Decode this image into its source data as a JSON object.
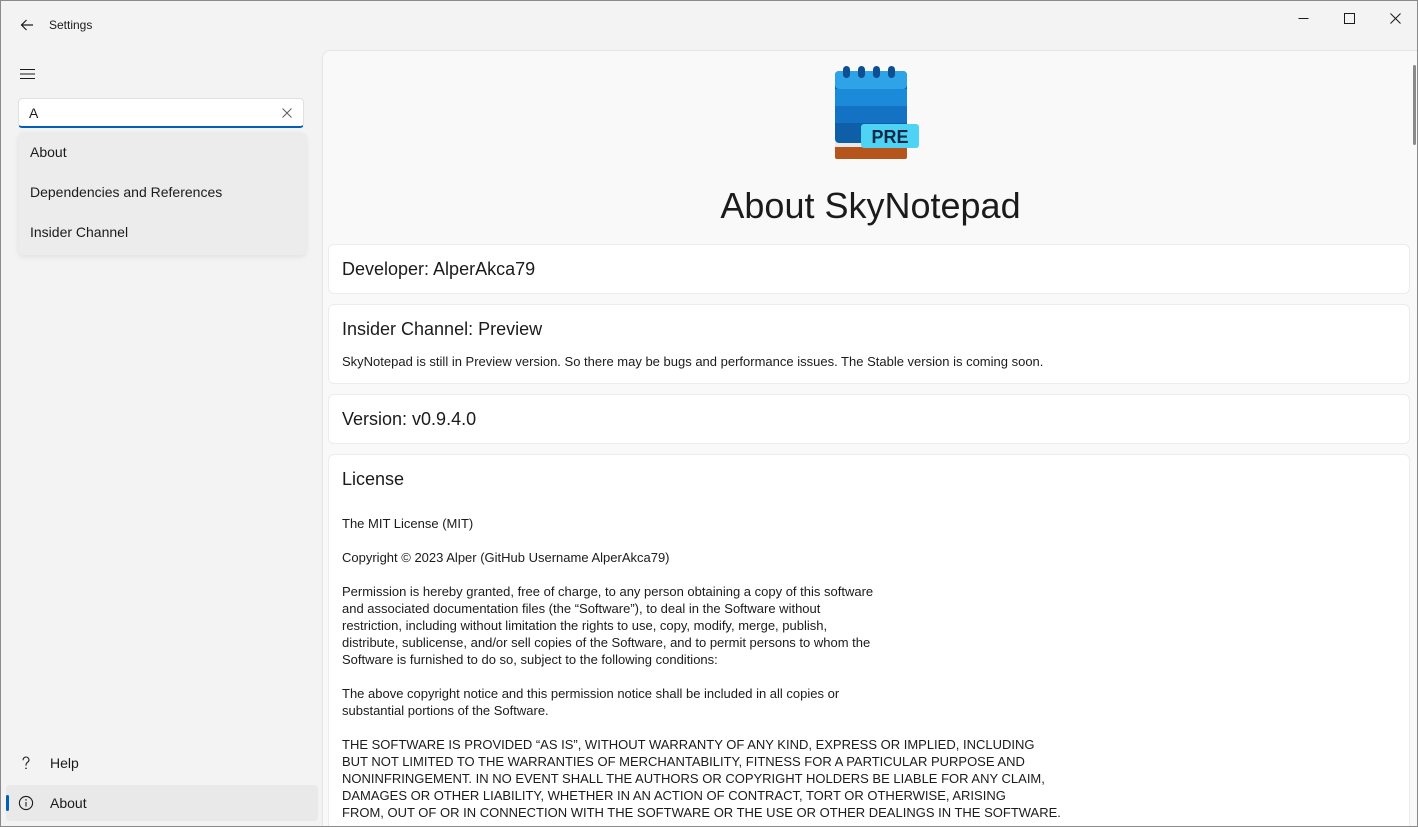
{
  "titlebar": {
    "title": "Settings",
    "back_icon": "back-arrow-icon",
    "minimize_icon": "minimize-icon",
    "maximize_icon": "maximize-icon",
    "close_icon": "close-icon"
  },
  "sidebar": {
    "menu_icon": "hamburger-icon",
    "search": {
      "value": "A",
      "clear_icon": "clear-icon"
    },
    "suggestions": [
      {
        "label": "About"
      },
      {
        "label": "Dependencies and References"
      },
      {
        "label": "Insider Channel"
      }
    ],
    "footer": [
      {
        "label": "Help",
        "icon": "help-icon"
      },
      {
        "label": "About",
        "icon": "info-icon",
        "selected": true
      }
    ]
  },
  "content": {
    "logo_badge": "PRE",
    "title": "About SkyNotepad",
    "developer": "Developer: AlperAkca79",
    "insider": {
      "heading": "Insider Channel: Preview",
      "text": "SkyNotepad is still in Preview version. So there may be bugs and performance issues. The Stable version is coming soon."
    },
    "version": "Version: v0.9.4.0",
    "license": {
      "heading": "License",
      "paragraphs": [
        "The MIT License (MIT)",
        "Copyright © 2023 Alper (GitHub Username AlperAkca79)",
        "Permission is hereby granted, free of charge, to any person obtaining a copy of this software\nand associated documentation files (the “Software”), to deal in the Software without\nrestriction, including without limitation the rights to use, copy, modify, merge, publish,\ndistribute, sublicense, and/or sell copies of the Software, and to permit persons to whom the\nSoftware is furnished to do so, subject to the following conditions:",
        "The above copyright notice and this permission notice shall be included in all copies or\nsubstantial portions of the Software.",
        "THE SOFTWARE IS PROVIDED “AS IS”, WITHOUT WARRANTY OF ANY KIND, EXPRESS OR IMPLIED, INCLUDING\nBUT NOT LIMITED TO THE WARRANTIES OF MERCHANTABILITY, FITNESS FOR A PARTICULAR PURPOSE AND\nNONINFRINGEMENT. IN NO EVENT SHALL THE AUTHORS OR COPYRIGHT HOLDERS BE LIABLE FOR ANY CLAIM,\nDAMAGES OR OTHER LIABILITY, WHETHER IN AN ACTION OF CONTRACT, TORT OR OTHERWISE, ARISING\nFROM, OUT OF OR IN CONNECTION WITH THE SOFTWARE OR THE USE OR OTHER DEALINGS IN THE SOFTWARE."
      ]
    }
  },
  "colors": {
    "accent": "#005fb8",
    "logo_blue_light": "#2ea3e8",
    "logo_blue_dark": "#0f5ea8",
    "logo_badge": "#4fd3f5",
    "logo_base": "#b5541b"
  }
}
